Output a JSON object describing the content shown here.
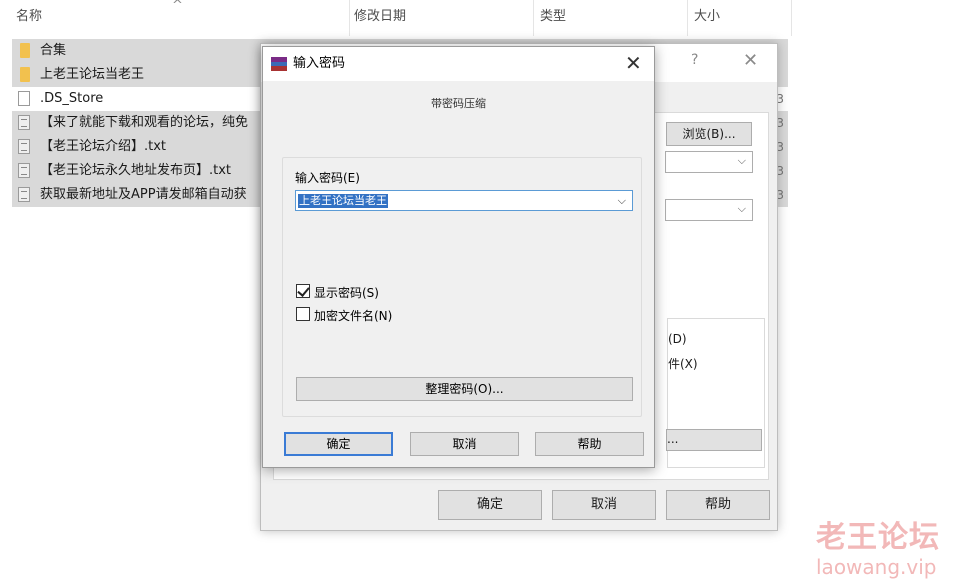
{
  "explorer": {
    "columns": [
      "名称",
      "修改日期",
      "类型",
      "大小"
    ],
    "sort_indicator": "^",
    "files": [
      {
        "name": "合集",
        "kind": "folder-icon",
        "suffix": ""
      },
      {
        "name": "上老王论坛当老王",
        "kind": "folder-icon",
        "suffix": ""
      },
      {
        "name": ".DS_Store",
        "kind": "doc-icon",
        "suffix": "3"
      },
      {
        "name": "【来了就能下载和观看的论坛，纯免",
        "kind": "txt-icon",
        "suffix": "3"
      },
      {
        "name": "【老王论坛介绍】.txt",
        "kind": "txt-icon",
        "suffix": "3"
      },
      {
        "name": "【老王论坛永久地址发布页】.txt",
        "kind": "txt-icon",
        "suffix": "3"
      },
      {
        "name": "获取最新地址及APP请发邮箱自动获",
        "kind": "txt-icon",
        "suffix": "3"
      }
    ]
  },
  "back_dialog": {
    "help_glyph": "?",
    "close_glyph": "✕",
    "browse_button": "浏览(B)...",
    "option_d": "(D)",
    "option_x": "件(X)",
    "ellipsis_button": "...",
    "ok_button": "确定",
    "cancel_button": "取消",
    "help_button": "帮助"
  },
  "password_dialog": {
    "title": "输入密码",
    "close_glyph": "✕",
    "subtitle": "带密码压缩",
    "field_label": "输入密码(E)",
    "password_value": "上老王论坛当老王",
    "show_password_label": "显示密码(S)",
    "show_password_checked": true,
    "encrypt_names_label": "加密文件名(N)",
    "encrypt_names_checked": false,
    "organize_button": "整理密码(O)...",
    "ok_button": "确定",
    "cancel_button": "取消",
    "help_button": "帮助"
  },
  "watermark": {
    "cn": "老王论坛",
    "en": "laowang.vip"
  },
  "colors": {
    "selection": "#3372c4",
    "row_highlight": "#d9d9d9",
    "dialog_bg": "#f0f0f0",
    "watermark": "#f2b8b8"
  }
}
